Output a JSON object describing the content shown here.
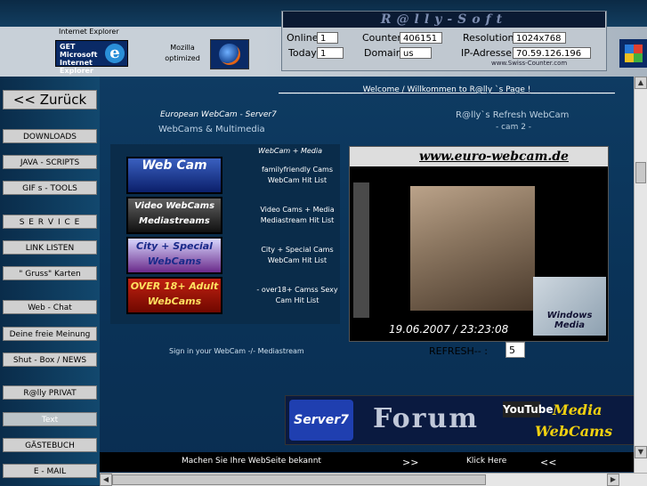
{
  "header": {
    "ie_label": "Internet Explorer",
    "ie_logo_text": "GET Microsoft Internet Explorer",
    "mozilla_label": "Mozilla optimized",
    "site_title": "R@lly-Soft",
    "stats": {
      "online_label": "Online",
      "online_value": "1",
      "today_label": "Today",
      "today_value": "1",
      "counter_label": "Counter",
      "counter_value": "406151",
      "domain_label": "Domain",
      "domain_value": "us",
      "resolution_label": "Resolution",
      "resolution_value": "1024x768",
      "ip_label": "IP-Adresse",
      "ip_value": "70.59.126.196"
    },
    "swiss_counter": "www.Swiss-Counter.com"
  },
  "nav": {
    "back": "<< Zurück",
    "items": [
      "DOWNLOADS",
      "JAVA - SCRIPTS",
      "GIF s - TOOLS",
      "S E R V I C E",
      "LINK LISTEN",
      "\" Gruss\" Karten",
      "Web - Chat",
      "Deine freie Meinung",
      "Shut - Box / NEWS",
      "R@lly PRIVAT",
      "Text",
      "GÄSTEBUCH",
      "E - MAIL"
    ]
  },
  "main": {
    "welcome": "_____________________Welcome / Willkommen to R@lly `s Page !_____________________",
    "euro_title": "European WebCam - Server7",
    "euro_sub": "WebCams & Multimedia",
    "refresh_title": "R@lly`s Refresh WebCam",
    "cam_sub": "- cam 2 -",
    "webcam_media_head": "WebCam + Media",
    "cam_buttons": [
      {
        "label": "Web Cam",
        "desc": "familyfriendly Cams WebCam Hit List"
      },
      {
        "label": "Video WebCams Mediastreams",
        "desc": "Video Cams + Media Mediastream Hit List"
      },
      {
        "label": "City + Special WebCams",
        "desc": "City + Special Cams WebCam Hit List"
      },
      {
        "label": "OVER 18+ Adult WebCams",
        "desc": "- over18+ Camss Sexy Cam Hit List"
      }
    ],
    "signin": "Sign in your WebCam -/- Mediastream",
    "cam_url": "www.euro-webcam.de",
    "cam_timestamp": "19.06.2007 / 23:23:08",
    "windows_media": "Windows Media",
    "refresh_label": "REFRESH-- :",
    "refresh_value": "5",
    "forum": {
      "server7": "Server7",
      "word": "Forum",
      "youtube": "YouTube",
      "media": "Media",
      "webcams": "WebCams"
    },
    "bottom": {
      "promo": "Machen Sie Ihre WebSeite bekannt",
      "arrows_left": ">>",
      "klick": "Klick Here",
      "arrows_right": "<<"
    }
  }
}
